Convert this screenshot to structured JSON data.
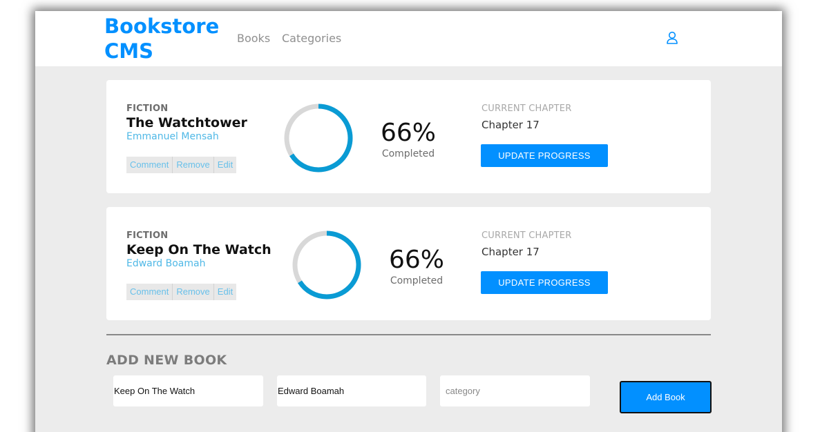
{
  "header": {
    "brand_line1": "Bookstore",
    "brand_line2": "CMS",
    "nav": [
      "Books",
      "Categories"
    ],
    "user_icon": "user-icon"
  },
  "books": [
    {
      "genre": "FICTION",
      "title": "The Watchtower",
      "author": "Emmanuel Mensah",
      "actions": [
        "Comment",
        "Remove",
        "Edit"
      ],
      "percent": 66,
      "percent_text": "66%",
      "completed_label": "Completed",
      "chapter_label": "CURRENT CHAPTER",
      "chapter": "Chapter 17",
      "update_label": "UPDATE PROGRESS"
    },
    {
      "genre": "FICTION",
      "title": "Keep On The Watch",
      "author": "Edward Boamah",
      "actions": [
        "Comment",
        "Remove",
        "Edit"
      ],
      "percent": 66,
      "percent_text": "66%",
      "completed_label": "Completed",
      "chapter_label": "CURRENT CHAPTER",
      "chapter": "Chapter 17",
      "update_label": "UPDATE PROGRESS"
    }
  ],
  "form": {
    "title": "ADD NEW BOOK",
    "title_value": "Keep On The Watch",
    "author_value": "Edward Boamah",
    "category_placeholder": "category",
    "submit_label": "Add Book"
  },
  "colors": {
    "accent": "#0290ff",
    "progress": "#0a9bd4",
    "track": "#d8d8d8",
    "author": "#4fb8e6"
  }
}
